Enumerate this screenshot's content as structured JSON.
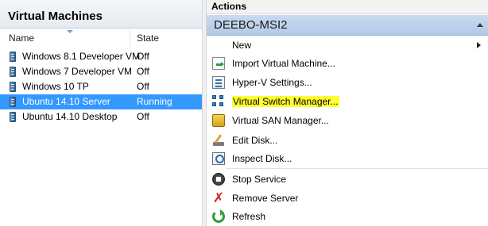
{
  "vm_pane": {
    "title": "Virtual Machines",
    "columns": {
      "name": "Name",
      "state": "State"
    },
    "rows": [
      {
        "name": "Windows 8.1 Developer VM",
        "state": "Off",
        "icon": "vm-icon",
        "selected": false
      },
      {
        "name": "Windows 7 Developer VM",
        "state": "Off",
        "icon": "vm-icon",
        "selected": false
      },
      {
        "name": "Windows 10 TP",
        "state": "Off",
        "icon": "vm-icon",
        "selected": false
      },
      {
        "name": "Ubuntu 14.10 Server",
        "state": "Running",
        "icon": "vm-icon",
        "selected": true
      },
      {
        "name": "Ubuntu 14.10 Desktop",
        "state": "Off",
        "icon": "vm-icon",
        "selected": false
      }
    ]
  },
  "actions_pane": {
    "title": "Actions",
    "group": "DEEBO-MSI2",
    "items": [
      {
        "label": "New",
        "icon": "none",
        "submenu": true
      },
      {
        "label": "Import Virtual Machine...",
        "icon": "import-icon"
      },
      {
        "label": "Hyper-V Settings...",
        "icon": "settings-icon"
      },
      {
        "label": "Virtual Switch Manager...",
        "icon": "network-switch-icon",
        "highlighted": true
      },
      {
        "label": "Virtual SAN Manager...",
        "icon": "san-icon"
      },
      {
        "label": "Edit Disk...",
        "icon": "edit-disk-icon"
      },
      {
        "label": "Inspect Disk...",
        "icon": "inspect-disk-icon"
      },
      {
        "label": "Stop Service",
        "icon": "stop-icon"
      },
      {
        "label": "Remove Server",
        "icon": "remove-icon"
      },
      {
        "label": "Refresh",
        "icon": "refresh-icon"
      }
    ]
  },
  "colors": {
    "selection": "#3399ff",
    "highlight": "#ffff33",
    "group_header": "#b2c9e6"
  }
}
